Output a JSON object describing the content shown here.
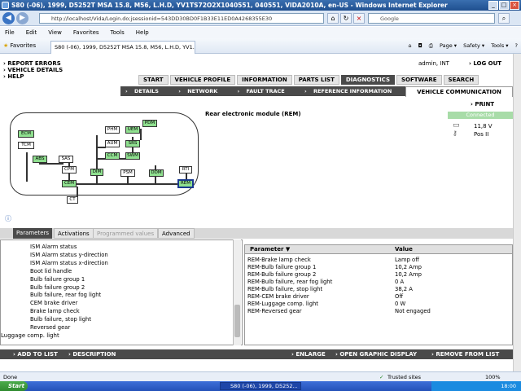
{
  "window": {
    "title": "S80 (-06), 1999, D5252T MSA 15.8, M56, L.H.D, YV1TS72O2X1040551, 040551, VIDA2010A, en-US - Windows Internet Explorer"
  },
  "browser": {
    "url": "http://localhost/Vida/Login.do;jsessionid=543DD30BD0F1B33E11ED0A4268355E30",
    "search_placeholder": "Google",
    "menu": [
      "File",
      "Edit",
      "View",
      "Favorites",
      "Tools",
      "Help"
    ],
    "favorites_label": "Favorites",
    "tab_title": "S80 (-06), 1999, D5252T MSA 15.8, M56, L.H.D, YV1...",
    "tools": [
      "Page ▾",
      "Safety ▾",
      "Tools ▾",
      "?"
    ]
  },
  "header": {
    "links": [
      "REPORT ERRORS",
      "VEHICLE DETAILS",
      "HELP"
    ],
    "user": "admin, INT",
    "logout": "LOG OUT"
  },
  "main_tabs": [
    "START",
    "VEHICLE PROFILE",
    "INFORMATION",
    "PARTS LIST",
    "DIAGNOSTICS",
    "SOFTWARE",
    "SEARCH"
  ],
  "active_tab": "DIAGNOSTICS",
  "sub_tabs": [
    "DETAILS",
    "NETWORK",
    "FAULT TRACE",
    "REFERENCE INFORMATION"
  ],
  "vehicle_communication": "VEHICLE COMMUNICATION",
  "module_title": "Rear electronic module (REM)",
  "print": "PRINT",
  "connection": {
    "status": "Connected",
    "voltage": "11,8 V",
    "key_position": "Pos II"
  },
  "network_nodes": [
    "ECM",
    "TCM",
    "ABS",
    "SAS",
    "CPM",
    "CEM",
    "CT",
    "PHM",
    "AUM",
    "UEM",
    "SRS",
    "PDM",
    "CCM",
    "SWM",
    "DIM",
    "PSM",
    "DDM",
    "RTI",
    "REM"
  ],
  "param_tabs": [
    "Parameters",
    "Activations",
    "Programmed values",
    "Advanced"
  ],
  "param_list": [
    "ISM Alarm status",
    "ISM Alarm status y-direction",
    "ISM Alarm status x-direction",
    "Boot lid handle",
    "Bulb failure group 1",
    "Bulb failure group 2",
    "Bulb failure, rear fog light",
    "CEM brake driver",
    "Brake lamp check",
    "Bulb failure, stop light",
    "Reversed gear",
    "Luggage comp. light"
  ],
  "values_table": {
    "headers": [
      "Parameter ▼",
      "Value"
    ],
    "rows": [
      [
        "REM-Brake lamp check",
        "Lamp off"
      ],
      [
        "REM-Bulb failure group 1",
        "10,2 Amp"
      ],
      [
        "REM-Bulb failure group 2",
        "10,2 Amp"
      ],
      [
        "REM-Bulb failure, rear fog light",
        "0 A"
      ],
      [
        "REM-Bulb failure, stop light",
        "38,2 A"
      ],
      [
        "REM-CEM brake driver",
        "Off"
      ],
      [
        "REM-Luggage comp. light",
        "0 W"
      ],
      [
        "REM-Reversed gear",
        "Not engaged"
      ]
    ]
  },
  "bottom_actions": {
    "add": "ADD TO LIST",
    "description": "DESCRIPTION",
    "enlarge": "ENLARGE",
    "graphic": "OPEN GRAPHIC DISPLAY",
    "remove": "REMOVE FROM LIST"
  },
  "status": {
    "left": "Done",
    "zone": "Trusted sites",
    "zoom": "100%"
  },
  "taskbar": {
    "start": "Start",
    "item": "S80 (-06), 1999, D5252...",
    "clock": "18:00"
  }
}
